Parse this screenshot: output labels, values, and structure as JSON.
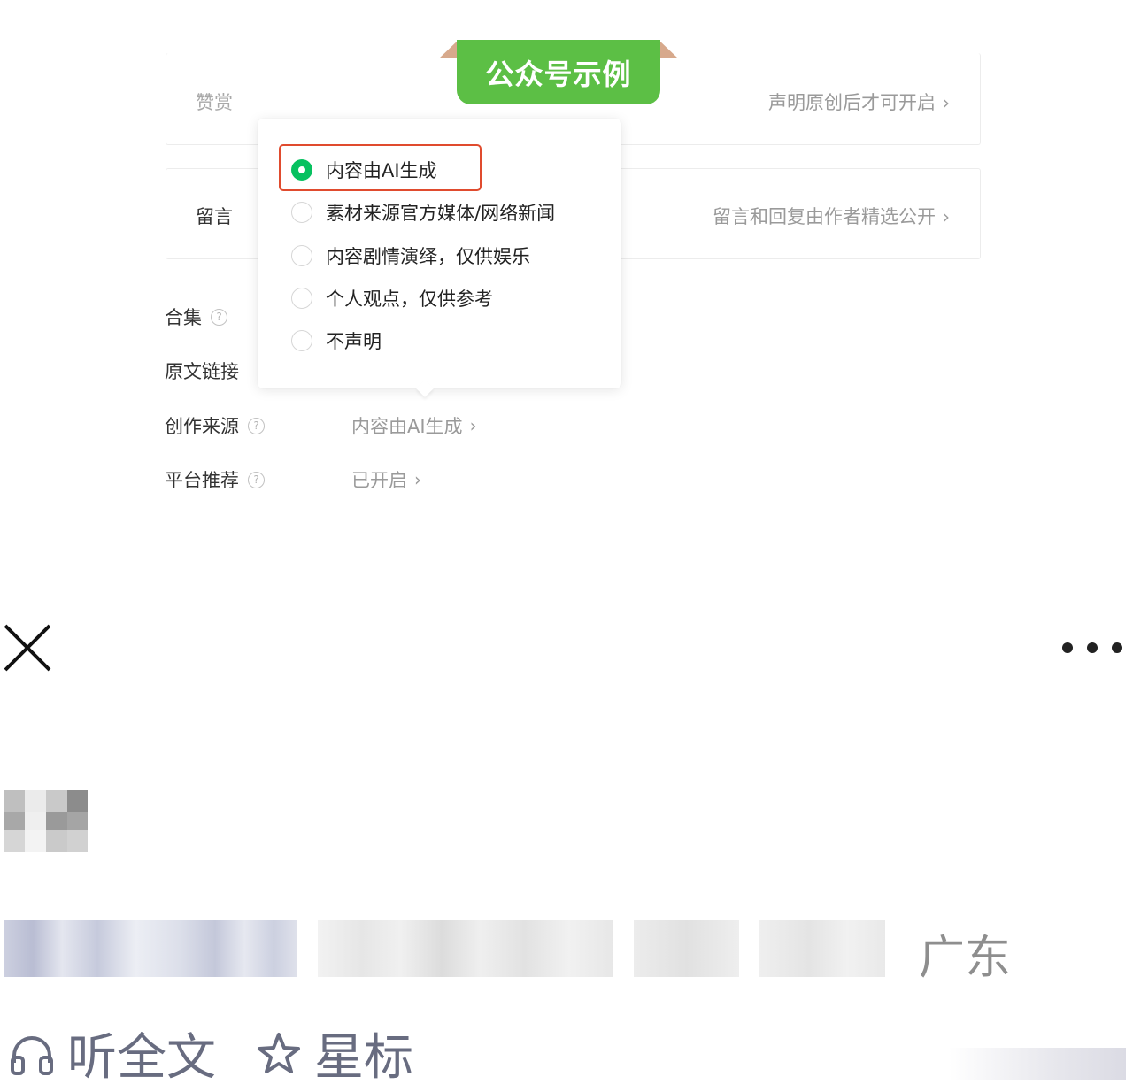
{
  "banner": {
    "label": "公众号示例"
  },
  "settings": {
    "reward": {
      "label": "赞赏",
      "hint": "声明原创后才可开启"
    },
    "comments": {
      "label": "留言",
      "hint": "留言和回复由作者精选公开"
    },
    "collection": {
      "label": "合集"
    },
    "original_link": {
      "label": "原文链接"
    },
    "creation_source": {
      "label": "创作来源",
      "value": "内容由AI生成"
    },
    "platform_recommend": {
      "label": "平台推荐",
      "value": "已开启"
    }
  },
  "source_popover": {
    "options": [
      {
        "label": "内容由AI生成",
        "selected": true
      },
      {
        "label": "素材来源官方媒体/网络新闻",
        "selected": false
      },
      {
        "label": "内容剧情演绎，仅供娱乐",
        "selected": false
      },
      {
        "label": "个人观点，仅供参考",
        "selected": false
      },
      {
        "label": "不声明",
        "selected": false
      }
    ]
  },
  "article": {
    "region": "广东",
    "listen_label": "听全文",
    "star_label": "星标"
  },
  "icons": {
    "help": "question-circle-icon",
    "chevron": "chevron-right-icon",
    "close": "close-icon",
    "more": "more-dots-icon",
    "listen": "headphones-icon",
    "star": "star-icon"
  },
  "colors": {
    "accent_green": "#07c160",
    "banner_green": "#5cbf45",
    "highlight_red": "#e04b2e"
  }
}
